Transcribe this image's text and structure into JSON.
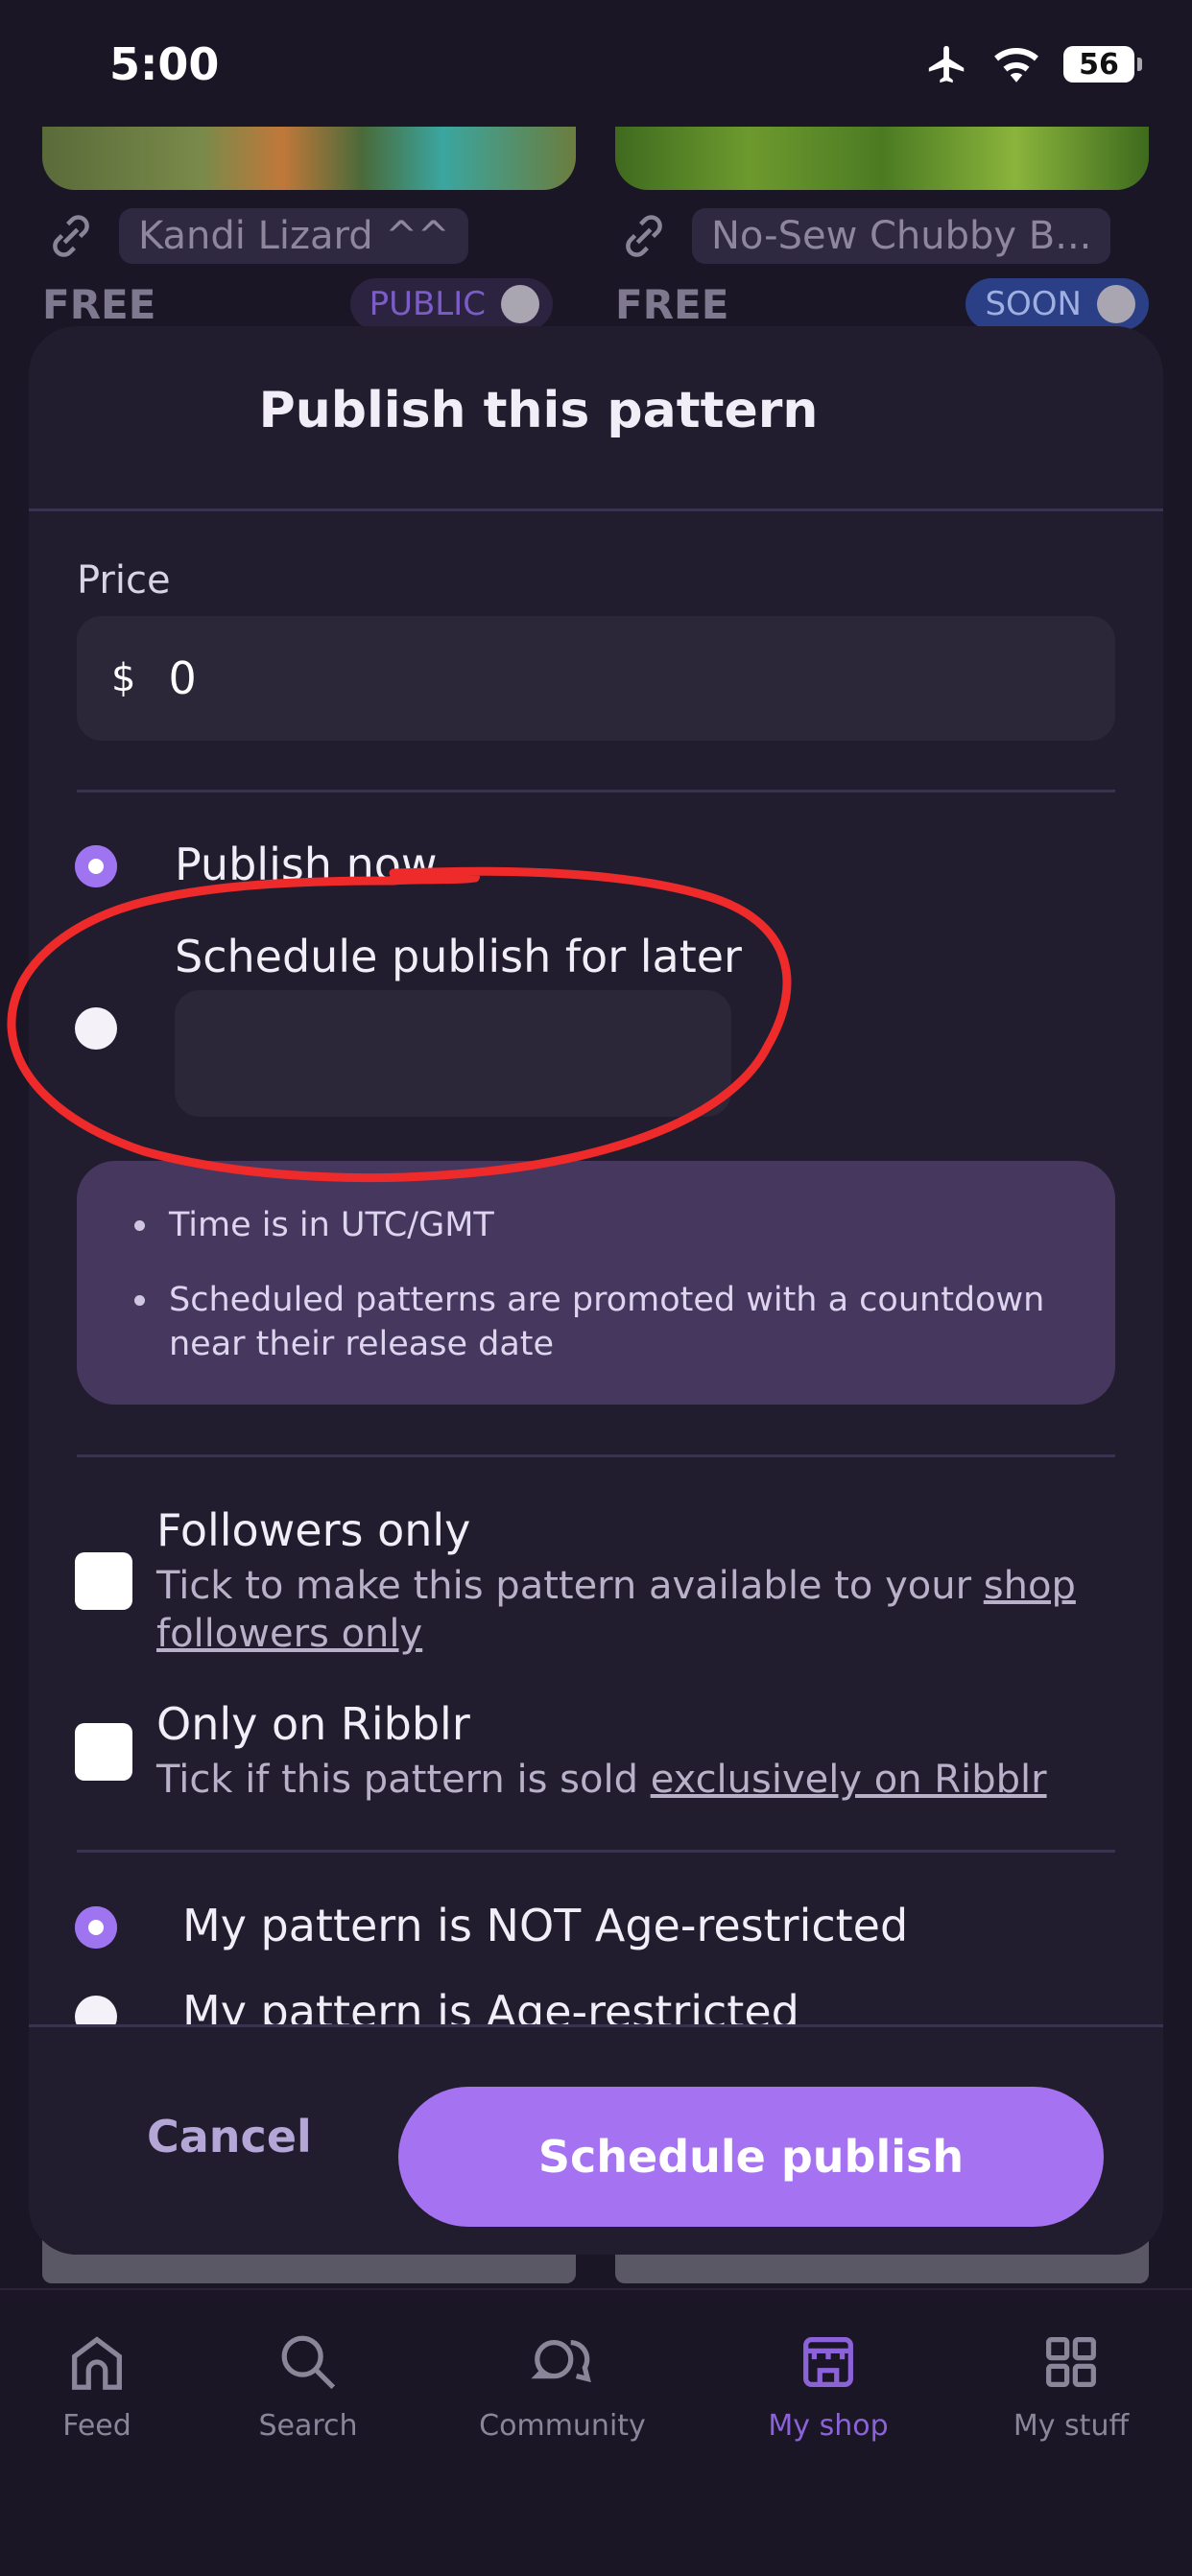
{
  "status_bar": {
    "time": "5:00",
    "battery": "56"
  },
  "background_cards": [
    {
      "name": "Kandi Lizard ^^",
      "price": "FREE",
      "toggle": "PUBLIC"
    },
    {
      "name": "No-Sew Chubby B...",
      "price": "FREE",
      "toggle": "SOON"
    }
  ],
  "sheet": {
    "title": "Publish this pattern",
    "price_label": "Price",
    "currency": "$",
    "price_value": "0",
    "publish_now": "Publish now",
    "schedule_later": "Schedule publish for later",
    "info": [
      "Time is in UTC/GMT",
      "Scheduled patterns are promoted with a countdown near their release date"
    ],
    "followers_title": "Followers only",
    "followers_desc_pre": "Tick to make this pattern available to your ",
    "followers_link": "shop followers only",
    "exclusive_title": "Only on Ribblr",
    "exclusive_desc_pre": "Tick if this pattern is sold ",
    "exclusive_link": "exclusively on Ribblr",
    "age_not_restricted": "My pattern is NOT Age-restricted",
    "age_restricted": "My pattern is Age-restricted",
    "cancel": "Cancel",
    "primary": "Schedule publish"
  },
  "tabs": [
    {
      "label": "Feed",
      "icon": "home-icon"
    },
    {
      "label": "Search",
      "icon": "search-icon"
    },
    {
      "label": "Community",
      "icon": "chat-icon"
    },
    {
      "label": "My shop",
      "icon": "shop-icon",
      "active": true
    },
    {
      "label": "My stuff",
      "icon": "grid-icon"
    }
  ],
  "colors": {
    "accent": "#a572f2",
    "annotation": "#ee2a2a",
    "sheet": "#221d2e"
  }
}
